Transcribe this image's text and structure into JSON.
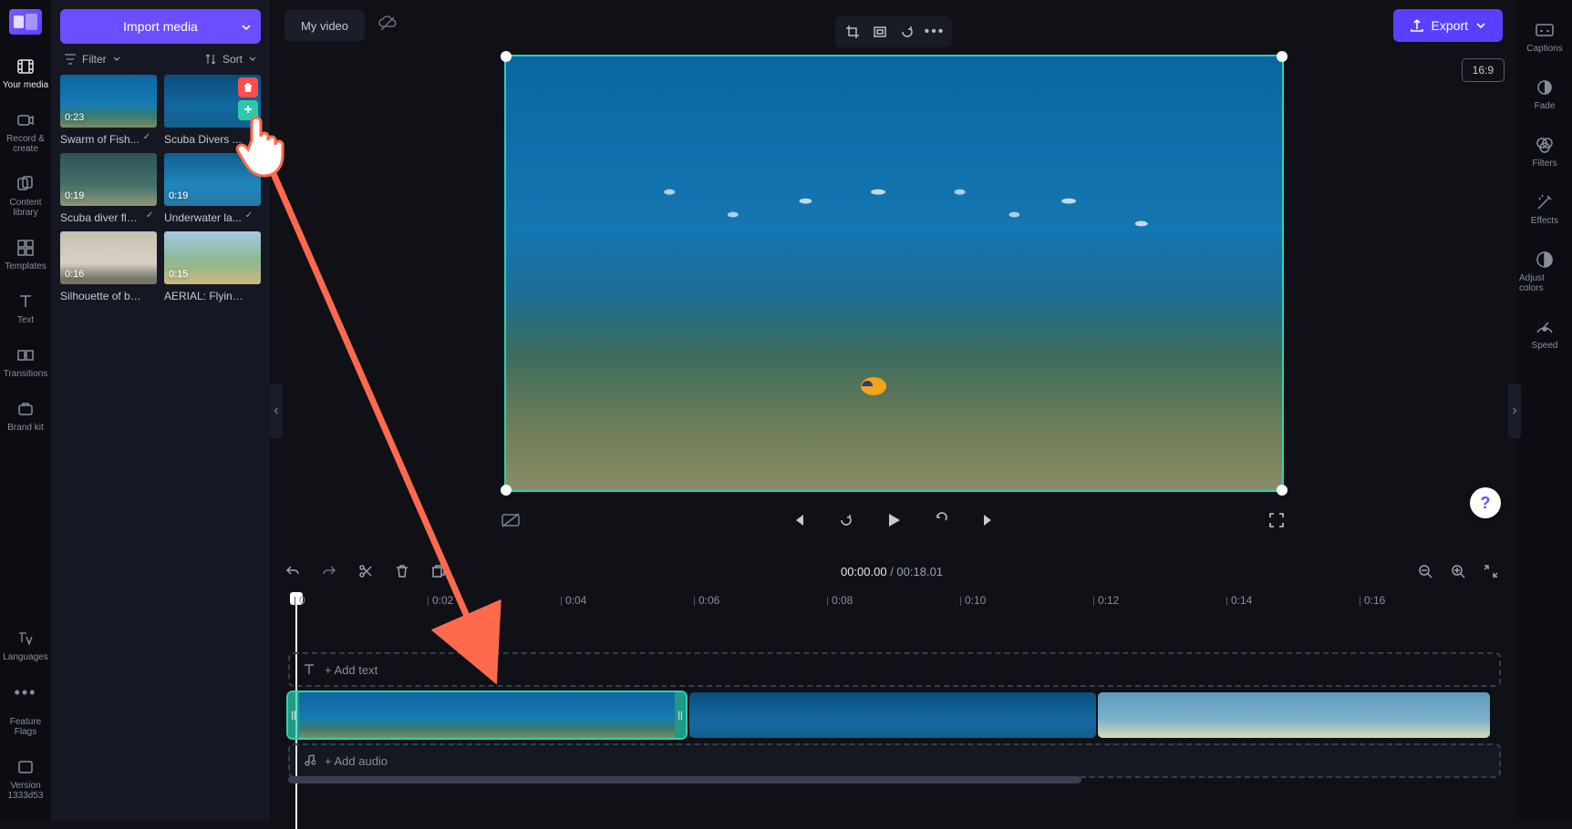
{
  "app": {
    "project_title": "My video",
    "aspect_ratio": "16:9",
    "export_label": "Export",
    "import_label": "Import media"
  },
  "left_nav": {
    "items": [
      {
        "label": "Your media"
      },
      {
        "label": "Record & create"
      },
      {
        "label": "Content library"
      },
      {
        "label": "Templates"
      },
      {
        "label": "Text"
      },
      {
        "label": "Transitions"
      },
      {
        "label": "Brand kit"
      }
    ],
    "bottom": [
      {
        "label": "Languages"
      },
      {
        "label": "..."
      },
      {
        "label": "Feature Flags"
      },
      {
        "label": "Version 1333d53"
      }
    ]
  },
  "right_nav": {
    "items": [
      {
        "label": "Captions"
      },
      {
        "label": "Fade"
      },
      {
        "label": "Filters"
      },
      {
        "label": "Effects"
      },
      {
        "label": "Adjust colors"
      },
      {
        "label": "Speed"
      }
    ]
  },
  "media_panel": {
    "filter_label": "Filter",
    "sort_label": "Sort",
    "clips": [
      {
        "name": "Swarm of Fish...",
        "duration": "0:23",
        "used": true,
        "thumb": "ocean"
      },
      {
        "name": "Scuba Divers ...",
        "duration": "",
        "used": false,
        "hover": true,
        "thumb": "ocean2"
      },
      {
        "name": "Scuba diver float...",
        "duration": "0:19",
        "used": true,
        "thumb": "ocean3"
      },
      {
        "name": "Underwater la...",
        "duration": "0:19",
        "used": true,
        "thumb": "ocean4"
      },
      {
        "name": "Silhouette of be...",
        "duration": "0:16",
        "used": false,
        "thumb": "yoga"
      },
      {
        "name": "AERIAL: Flying a...",
        "duration": "0:15",
        "used": false,
        "thumb": "palms"
      }
    ]
  },
  "transport": {
    "current_time": "00:00.00",
    "total_time": "00:18.01"
  },
  "timeline": {
    "ticks": [
      "0",
      "0:02",
      "0:04",
      "0:06",
      "0:08",
      "0:10",
      "0:12",
      "0:14",
      "0:16"
    ],
    "add_text_label": "+ Add text",
    "add_audio_label": "+ Add audio"
  },
  "tl_tools": {
    "undo": "undo",
    "redo": "redo",
    "cut": "cut",
    "delete": "delete",
    "split": "split"
  }
}
